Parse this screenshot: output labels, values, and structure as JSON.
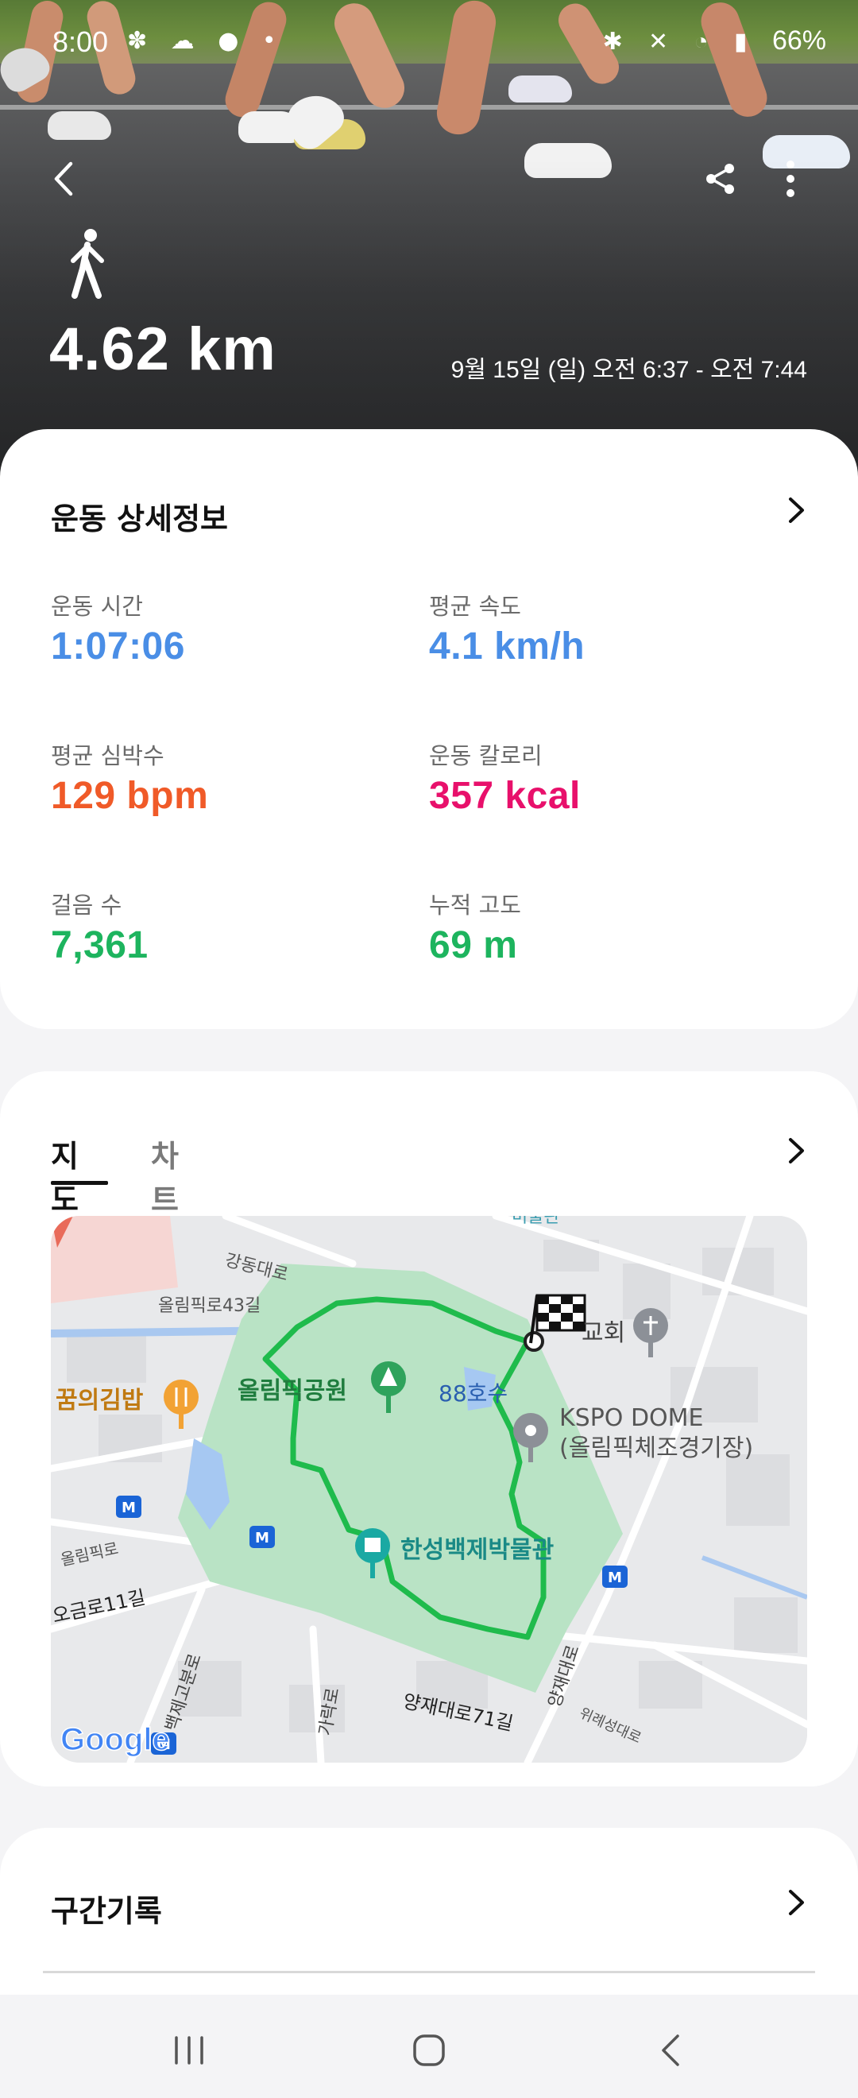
{
  "status_bar": {
    "time": "8:00",
    "left_icons": [
      "flower-icon",
      "sky-icon",
      "chat-icon",
      "dot-icon"
    ],
    "left_glyphs": "✽ ☁ ● •",
    "right_glyphs": "✱ ✕ ◔ ▮",
    "battery": "66%"
  },
  "header": {
    "activity_icon": "walking-icon",
    "distance": "4.62 km",
    "date_range": "9월 15일 (일) 오전 6:37 - 오전 7:44"
  },
  "details_card": {
    "title": "운동 상세정보",
    "stats": [
      {
        "label": "운동 시간",
        "value": "1:07:06",
        "color": "#4a8ee6"
      },
      {
        "label": "평균 속도",
        "value": "4.1 km/h",
        "color": "#4a8ee6"
      },
      {
        "label": "평균 심박수",
        "value": "129 bpm",
        "color": "#f05a28"
      },
      {
        "label": "운동 칼로리",
        "value": "357 kcal",
        "color": "#e8106b"
      },
      {
        "label": "걸음 수",
        "value": "7,361",
        "color": "#1db45e"
      },
      {
        "label": "누적 고도",
        "value": "69 m",
        "color": "#1db45e"
      }
    ]
  },
  "map_card": {
    "tabs": [
      {
        "label": "지도",
        "active": true
      },
      {
        "label": "차트",
        "active": false
      }
    ],
    "map_labels": {
      "road_gangdong": "강동대로",
      "road_olympic43": "올림픽로43길",
      "park": "올림픽공원",
      "lake": "88호수",
      "church": "교회",
      "dome_name": "KSPO DOME",
      "dome_sub": "(올림픽체조경기장)",
      "museum": "한성백제박물관",
      "restaurant": "꿈의김밥",
      "road_olympic": "올림픽로",
      "road_ogeum11": "오금로11길",
      "road_baekje": "백제고분로",
      "road_garak": "가락로",
      "road_yangjae71": "양재대로71길",
      "road_yangjae": "양재대로",
      "road_wirye": "위례성대로",
      "top_partial": "미술관",
      "metro": "M",
      "google": "Google"
    }
  },
  "laps_card": {
    "title": "구간기록"
  },
  "nav": {
    "recent_icon": "recent-apps-icon",
    "home_icon": "home-icon",
    "back_icon": "back-icon"
  }
}
